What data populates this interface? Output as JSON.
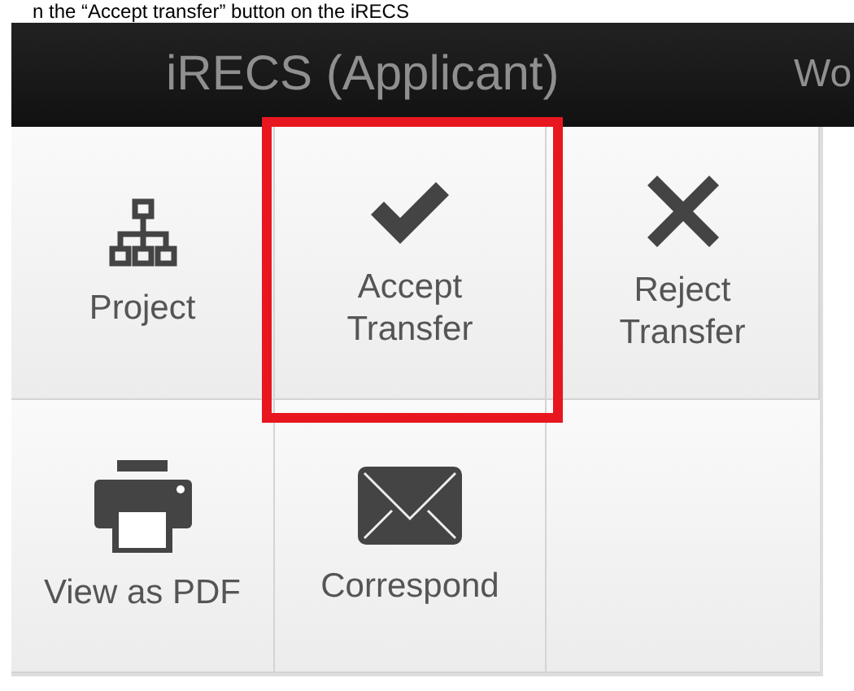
{
  "caption": "n the “Accept transfer” button on the iRECS",
  "header": {
    "title": "iRECS (Applicant)",
    "next_item": "Wo"
  },
  "tiles": [
    {
      "label": "Project",
      "kind": "hierarchy",
      "highlighted": false
    },
    {
      "label": "Accept Transfer",
      "kind": "check",
      "highlighted": true
    },
    {
      "label": "Reject Transfer",
      "kind": "cross",
      "highlighted": false
    },
    {
      "label": "View as PDF",
      "kind": "printer",
      "highlighted": false
    },
    {
      "label": "Correspond",
      "kind": "envelope",
      "highlighted": false
    }
  ]
}
